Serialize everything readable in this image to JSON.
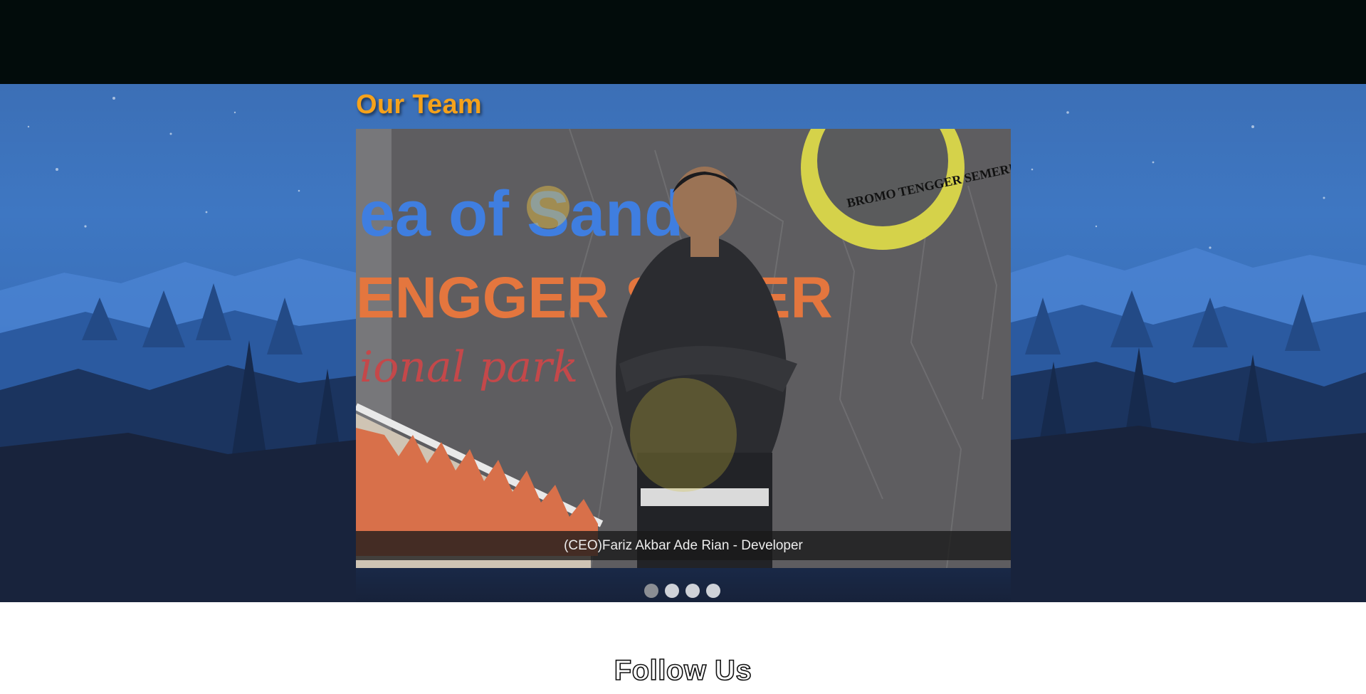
{
  "section": {
    "title": "Our Team"
  },
  "slider": {
    "active_index": 0,
    "slides": [
      {
        "caption": "(CEO)Fariz Akbar Ade Rian - Developer"
      }
    ],
    "dot_count": 4,
    "photo_sign": {
      "line1": "ea of Sand",
      "line2": "ENGGER SEMER",
      "line3": "ional park",
      "badge": "BROMO TENGGER SEMERU"
    }
  },
  "follow": {
    "title": "Follow Us"
  },
  "colors": {
    "accent": "#f5a21b",
    "topbar": "#020c0b",
    "caption_bg": "#191919"
  }
}
